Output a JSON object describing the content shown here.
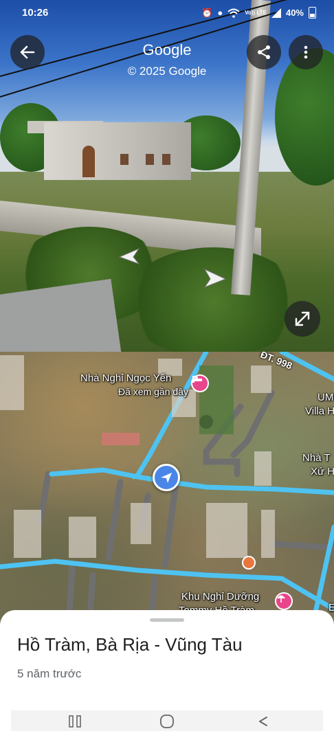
{
  "status_bar": {
    "time": "10:26",
    "signal_text": "Vo)) LTE",
    "battery_text": "40%"
  },
  "header": {
    "title": "Google",
    "subtitle": "© 2025 Google"
  },
  "map": {
    "road_label": "ĐT. 998",
    "places": [
      {
        "name": "Nhà Nghỉ Ngọc Yến",
        "note": "Đã xem gần đây"
      },
      {
        "name": "UM",
        "note": "Villa H"
      },
      {
        "name": "Nhà T",
        "note": "Xứ H"
      },
      {
        "name": "Khu Nghỉ Dưỡng",
        "note": "Tommy Hồ Tràm"
      },
      {
        "name": "E",
        "note": ""
      }
    ],
    "route_color": "#4ec3f2",
    "marker_color": "#4a86e8",
    "poi_color": "#e8458b"
  },
  "sheet": {
    "place_name": "Hồ Tràm, Bà Rịa - Vũng Tàu",
    "capture_date": "5 năm trước"
  },
  "icons": {
    "back": "arrow-left-icon",
    "share": "share-icon",
    "more": "more-vert-icon",
    "expand": "expand-icon",
    "recents": "recents-icon",
    "home": "home-icon",
    "nav_back": "nav-back-icon"
  }
}
